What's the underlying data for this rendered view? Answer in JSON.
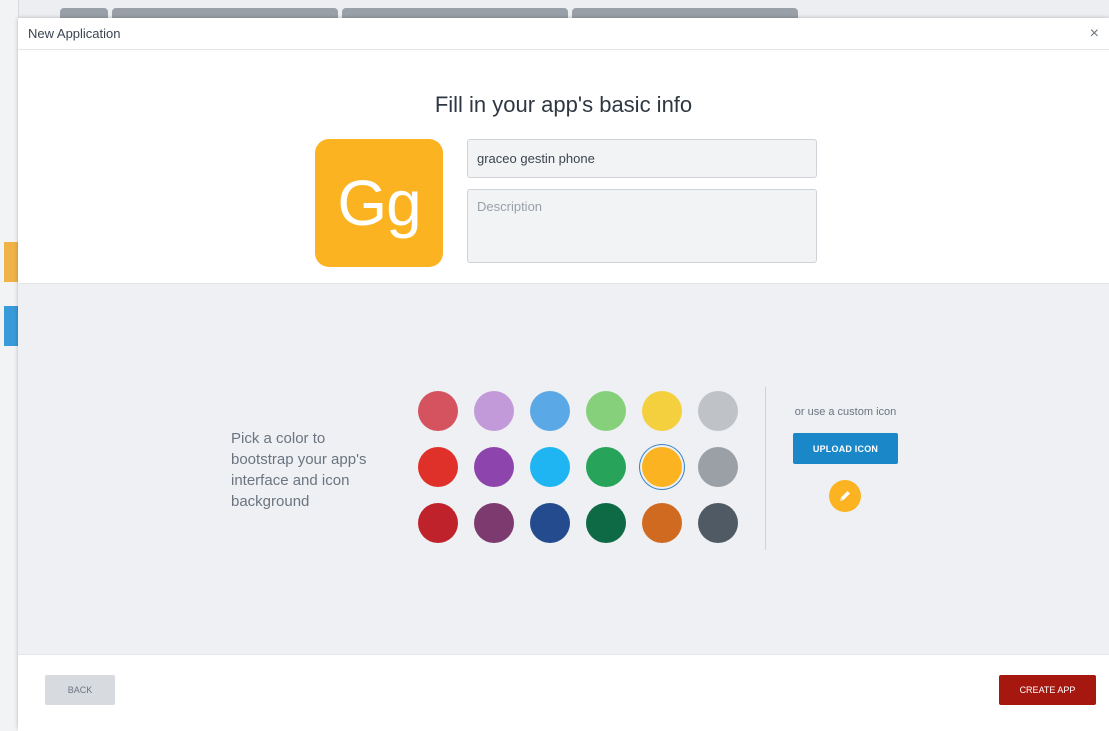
{
  "window": {
    "title": "New Application",
    "close_glyph": "×"
  },
  "basic_info": {
    "heading": "Fill in your app's basic info",
    "icon_initials": "Gg",
    "icon_color": "#fbb321",
    "name_value": "graceo gestin phone",
    "description_placeholder": "Description"
  },
  "color_picker": {
    "prompt": "Pick a color to bootstrap your app's interface and icon background",
    "selected": "#fbb321",
    "rows": [
      [
        "#d5535f",
        "#c39ad9",
        "#5aa9e6",
        "#86d07c",
        "#f4d03f",
        "#bfc3c7"
      ],
      [
        "#e0302a",
        "#8e44ad",
        "#1fb5f2",
        "#27a35a",
        "#fbb321",
        "#9aa0a6"
      ],
      [
        "#bf222b",
        "#7c3a6f",
        "#244b8d",
        "#0e6a45",
        "#d06a21",
        "#4f5a64"
      ]
    ]
  },
  "custom_icon": {
    "label": "or use a custom icon",
    "upload_label": "UPLOAD ICON",
    "edit_icon": "pencil-icon"
  },
  "footer": {
    "back_label": "BACK",
    "create_label": "CREATE APP",
    "create_color": "#a6180f"
  }
}
